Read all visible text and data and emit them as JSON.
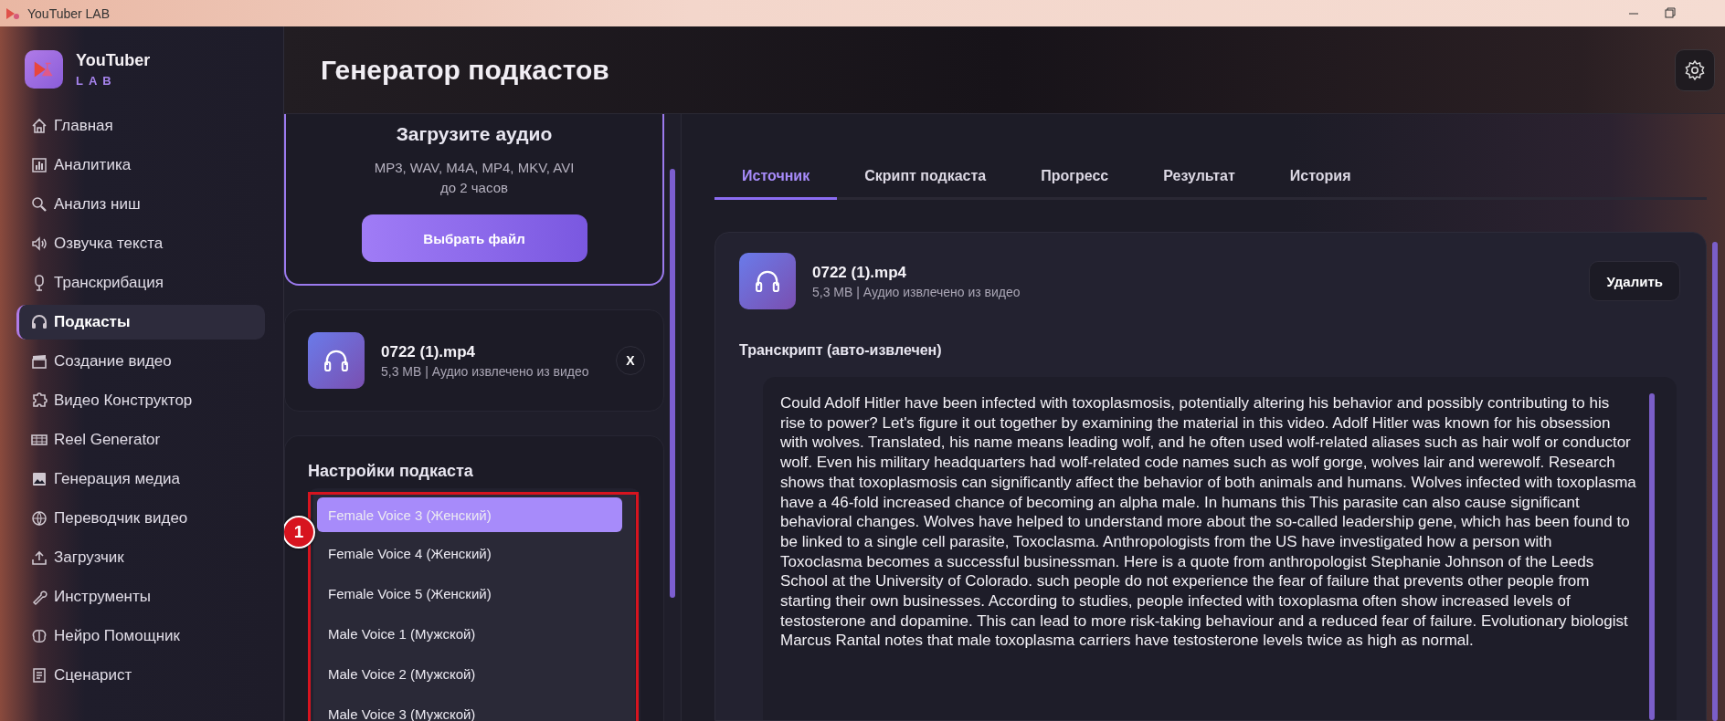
{
  "window": {
    "title": "YouTuber LAB"
  },
  "brand": {
    "name": "YouTuber",
    "sub": "LAB"
  },
  "sidebar": {
    "items": [
      {
        "label": "Главная",
        "selected": false
      },
      {
        "label": "Аналитика",
        "selected": false
      },
      {
        "label": "Анализ ниш",
        "selected": false
      },
      {
        "label": "Озвучка текста",
        "selected": false
      },
      {
        "label": "Транскрибация",
        "selected": false
      },
      {
        "label": "Подкасты",
        "selected": true
      },
      {
        "label": "Создание видео",
        "selected": false
      },
      {
        "label": "Видео Конструктор",
        "selected": false
      },
      {
        "label": "Reel Generator",
        "selected": false
      },
      {
        "label": "Генерация медиа",
        "selected": false
      },
      {
        "label": "Переводчик видео",
        "selected": false
      },
      {
        "label": "Загрузчик",
        "selected": false
      },
      {
        "label": "Инструменты",
        "selected": false
      },
      {
        "label": "Нейро Помощник",
        "selected": false
      },
      {
        "label": "Сценарист",
        "selected": false
      }
    ]
  },
  "header": {
    "title": "Генератор подкастов"
  },
  "upload": {
    "title": "Загрузите аудио",
    "formats": "MP3, WAV, M4A, MP4, MKV, AVI",
    "limit": "до 2 часов",
    "button": "Выбрать файл"
  },
  "file_card": {
    "name": "0722 (1).mp4",
    "meta": "5,3 MB | Аудио извлечено из видео",
    "remove": "X"
  },
  "settings": {
    "title": "Настройки подкаста",
    "badge": "1",
    "options": [
      {
        "label": "Female Voice 3 (Женский)",
        "selected": true
      },
      {
        "label": "Female Voice 4 (Женский)",
        "selected": false
      },
      {
        "label": "Female Voice 5 (Женский)",
        "selected": false
      },
      {
        "label": "Male Voice 1 (Мужской)",
        "selected": false
      },
      {
        "label": "Male Voice 2 (Мужской)",
        "selected": false
      },
      {
        "label": "Male Voice 3 (Мужской)",
        "selected": false
      }
    ]
  },
  "tabs": [
    {
      "label": "Источник",
      "selected": true
    },
    {
      "label": "Скрипт подкаста",
      "selected": false
    },
    {
      "label": "Прогресс",
      "selected": false
    },
    {
      "label": "Результат",
      "selected": false
    },
    {
      "label": "История",
      "selected": false
    }
  ],
  "source": {
    "name": "0722 (1).mp4",
    "meta": "5,3 MB | Аудио извлечено из видео",
    "delete": "Удалить",
    "transcript_label": "Транскрипт (авто-извлечен)",
    "transcript": "Could Adolf Hitler have been infected with toxoplasmosis, potentially altering his behavior and possibly contributing to his rise to power? Let's figure it out together by examining the material in this video. Adolf Hitler was known for his obsession with wolves. Translated, his name means leading wolf, and he often used wolf-related aliases such as hair wolf or conductor wolf. Even his military headquarters had wolf-related code names such as wolf gorge, wolves lair and werewolf. Research shows that toxoplasmosis can significantly affect the behavior of both animals and humans. Wolves infected with toxoplasma have a 46-fold increased chance of becoming an alpha male. In humans this This parasite can also cause significant behavioral changes. Wolves have helped to understand more about the so-called leadership gene, which has been found to be linked to a single cell parasite, Toxoclasma. Anthropologists from the US have investigated how a person with Toxoclasma becomes a successful businessman. Here is a quote from anthropologist Stephanie Johnson of the Leeds School at the University of Colorado. such people do not experience the fear of failure that prevents other people from starting their own businesses. According to studies, people infected with toxoplasma often show increased levels of testosterone and dopamine. This can lead to more risk-taking behaviour and a reduced fear of failure. Evolutionary biologist Marcus Rantal notes that male toxoplasma carriers have testosterone levels twice as high as normal."
  }
}
